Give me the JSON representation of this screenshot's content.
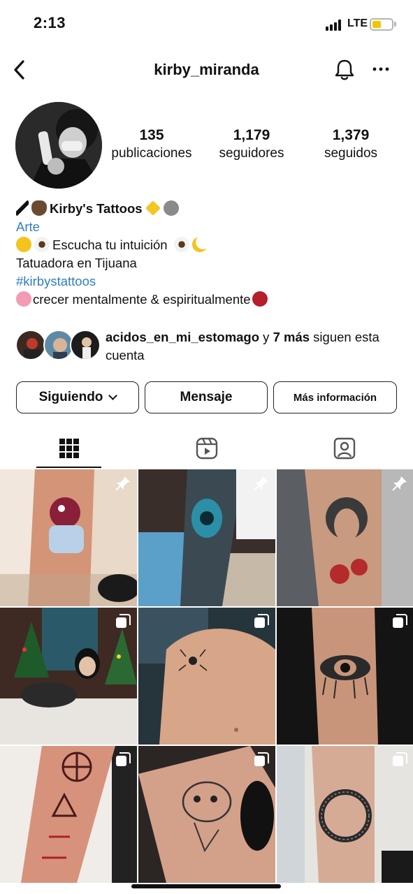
{
  "status_bar": {
    "time": "2:13",
    "network": "LTE",
    "battery_level": 0.45
  },
  "header": {
    "username": "kirby_miranda",
    "back_icon": "chevron-left-icon",
    "bell_icon": "bell-icon",
    "more_icon": "more-icon"
  },
  "profile": {
    "stats": [
      {
        "value": "135",
        "label": "publicaciones"
      },
      {
        "value": "1,179",
        "label": "seguidores"
      },
      {
        "value": "1,379",
        "label": "seguidos"
      }
    ],
    "bio": {
      "name": "Kirby's Tattoos",
      "category": "Arte",
      "line1": "Escucha tu intuición",
      "line2": "Tatuadora en Tijuana",
      "hashtag": "#kirbystattoos",
      "line3": "crecer mentalmente & espiritualmente"
    },
    "followed_by": {
      "account": "acidos_en_mi_estomago",
      "connector": " y ",
      "others": "7 más",
      "suffix": " siguen esta cuenta"
    }
  },
  "buttons": {
    "following": "Siguiendo",
    "message": "Mensaje",
    "more_info": "Más información"
  },
  "tabs": [
    {
      "name": "grid",
      "icon": "grid-icon",
      "active": true
    },
    {
      "name": "reels",
      "icon": "reels-icon",
      "active": false
    },
    {
      "name": "tagged",
      "icon": "tagged-icon",
      "active": false
    }
  ],
  "posts": [
    {
      "subject": "cartoon tattoo on leg",
      "badge": "pin-icon"
    },
    {
      "subject": "eye tattoo on forearm",
      "badge": "pin-icon"
    },
    {
      "subject": "medusa tattoo on arm",
      "badge": "pin-icon"
    },
    {
      "subject": "woman with dog by christmas tree",
      "badge": "carousel-icon"
    },
    {
      "subject": "spider tattoo on shoulder",
      "badge": "carousel-icon"
    },
    {
      "subject": "eye tattoo on arm",
      "badge": "carousel-icon"
    },
    {
      "subject": "red rune tattoo on forearm",
      "badge": "carousel-icon"
    },
    {
      "subject": "fish creature tattoo on arm",
      "badge": "carousel-icon"
    },
    {
      "subject": "ouroboros tattoo on forearm",
      "badge": "carousel-icon"
    }
  ]
}
